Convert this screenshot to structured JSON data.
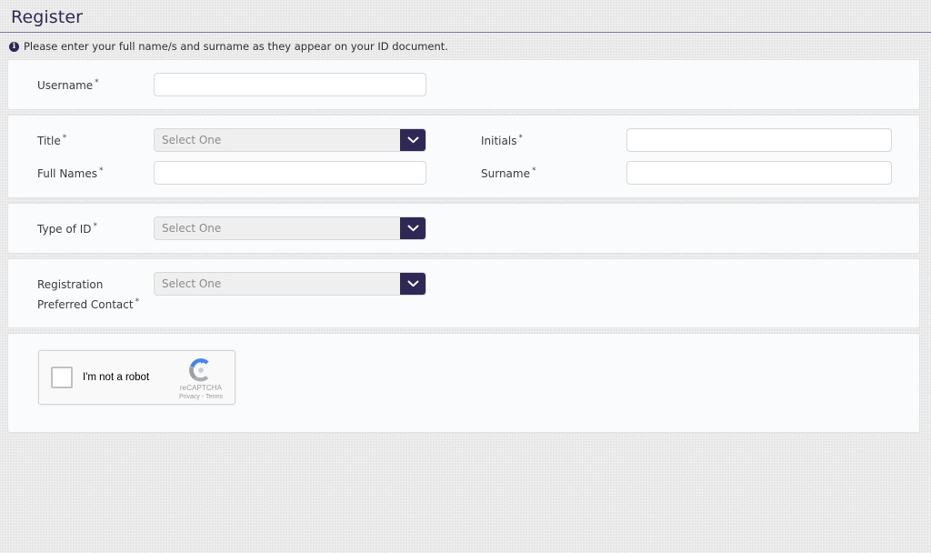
{
  "header": {
    "title": "Register"
  },
  "info": {
    "icon": "info-circle-icon",
    "text": "Please enter your full name/s and surname as they appear on your ID document."
  },
  "theme": {
    "accent": "#2F2756",
    "title_rule": "#7A74A0",
    "panel_bg": "#FAFBFD",
    "panel_border": "#E2E2E2",
    "page_bg": "#E8E8E8",
    "select_bg": "#EFEFF0",
    "placeholder_color": "#8B8B90"
  },
  "required_marker": "*",
  "sections": [
    {
      "name": "username-section",
      "rows": [
        {
          "left": {
            "label": "Username",
            "required": true,
            "type": "text",
            "value": "",
            "placeholder": "",
            "name": "username"
          }
        }
      ]
    },
    {
      "name": "name-section",
      "rows": [
        {
          "left": {
            "label": "Title",
            "required": true,
            "type": "select",
            "value": "Select One",
            "name": "title"
          },
          "right": {
            "label": "Initials",
            "required": true,
            "type": "text",
            "value": "",
            "placeholder": "",
            "name": "initials"
          }
        },
        {
          "left": {
            "label": "Full Names",
            "required": true,
            "type": "text",
            "value": "",
            "placeholder": "",
            "name": "full-names"
          },
          "right": {
            "label": "Surname",
            "required": true,
            "type": "text",
            "value": "",
            "placeholder": "",
            "name": "surname"
          }
        }
      ]
    },
    {
      "name": "id-section",
      "rows": [
        {
          "left": {
            "label": "Type of ID",
            "required": true,
            "type": "select",
            "value": "Select One",
            "name": "type-of-id"
          }
        }
      ]
    },
    {
      "name": "contact-section",
      "rows": [
        {
          "left": {
            "label": "Registration Preferred Contact",
            "required": true,
            "type": "select",
            "value": "Select One",
            "name": "registration-preferred-contact"
          }
        }
      ]
    }
  ],
  "captcha": {
    "checkbox_label": "I'm not a robot",
    "brand_name": "reCAPTCHA",
    "links": "Privacy - Terms",
    "logo_icon": "recaptcha-logo-icon",
    "checked": false
  }
}
